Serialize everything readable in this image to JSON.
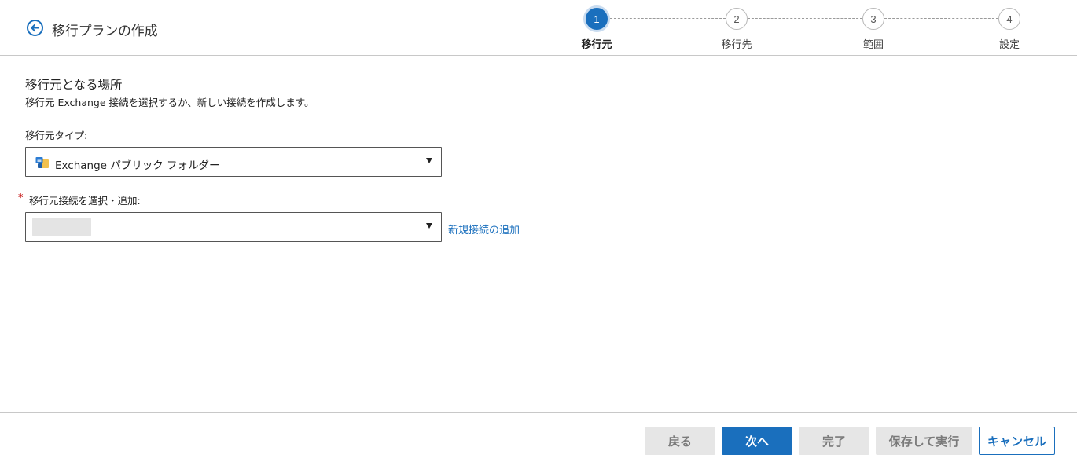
{
  "header": {
    "title": "移行プランの作成"
  },
  "stepper": {
    "steps": [
      {
        "number": "1",
        "label": "移行元",
        "active": true
      },
      {
        "number": "2",
        "label": "移行先",
        "active": false
      },
      {
        "number": "3",
        "label": "範囲",
        "active": false
      },
      {
        "number": "4",
        "label": "設定",
        "active": false
      }
    ]
  },
  "main": {
    "section_title": "移行元となる場所",
    "section_desc": "移行元 Exchange 接続を選択するか、新しい接続を作成します。",
    "source_type": {
      "label": "移行元タイプ:",
      "value": "Exchange パブリック フォルダー",
      "icon": "exchange-public-folder-icon"
    },
    "source_connection": {
      "required_marker": "*",
      "label": "移行元接続を選択・追加:",
      "value": "",
      "add_link": "新規接続の追加"
    }
  },
  "footer": {
    "back": "戻る",
    "next": "次へ",
    "finish": "完了",
    "save_run": "保存して実行",
    "cancel": "キャンセル"
  },
  "colors": {
    "accent": "#1a6fbd",
    "required": "#c00000",
    "disabled_bg": "#e6e6e6"
  }
}
